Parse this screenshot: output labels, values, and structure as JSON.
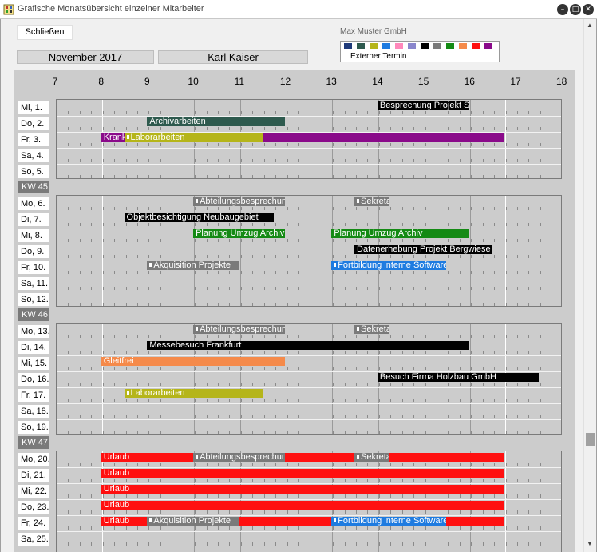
{
  "window": {
    "title": "Grafische Monatsübersicht einzelner Mitarbeiter"
  },
  "toolbar": {
    "close_label": "Schließen",
    "month": "November 2017",
    "employee": "Karl Kaiser"
  },
  "company": "Max Muster GmbH",
  "legend": {
    "colors": [
      "#1f3a7a",
      "#2e5a4e",
      "#b5b51a",
      "#1e7be0",
      "#ff88bb",
      "#8a86cc",
      "#000000",
      "#7a7a7a",
      "#148a14",
      "#f58a4a",
      "#ff1010",
      "#8a0a8a"
    ],
    "label": "Externer Termin"
  },
  "hours": [
    "7",
    "8",
    "9",
    "10",
    "11",
    "12",
    "13",
    "14",
    "15",
    "16",
    "17",
    "18"
  ],
  "weeks": [
    {
      "kw": null,
      "days": [
        "Mi,  1.",
        "Do, 2.",
        "Fr,  3.",
        "Sa, 4.",
        "So, 5."
      ]
    },
    {
      "kw": "KW 45",
      "days": [
        "Mo, 6.",
        "Di,  7.",
        "Mi,  8.",
        "Do, 9.",
        "Fr,  10.",
        "Sa, 11.",
        "So, 12."
      ]
    },
    {
      "kw": "KW 46",
      "days": [
        "Mo, 13.",
        "Di,  14.",
        "Mi,  15.",
        "Do, 16.",
        "Fr,  17.",
        "Sa, 18.",
        "So, 19."
      ]
    },
    {
      "kw": "KW 47",
      "days": [
        "Mo, 20.",
        "Di,  21.",
        "Mi,  22.",
        "Do, 23.",
        "Fr,  24.",
        "Sa, 25."
      ]
    }
  ],
  "events": [
    {
      "week": 0,
      "row": 0,
      "start": 14.0,
      "end": 16.0,
      "label": "Besprechung Projekt Schulung",
      "color": "#000000",
      "marker": false
    },
    {
      "week": 0,
      "row": 1,
      "start": 9.0,
      "end": 12.0,
      "label": "Archivarbeiten",
      "color": "#2e5a4e",
      "marker": false
    },
    {
      "week": 0,
      "row": 2,
      "start": 8.0,
      "end": 16.75,
      "label": "Krank",
      "color": "#8a0a8a",
      "marker": false
    },
    {
      "week": 0,
      "row": 2,
      "start": 8.5,
      "end": 11.5,
      "label": "Laborarbeiten",
      "color": "#b5b51a",
      "marker": true
    },
    {
      "week": 1,
      "row": 0,
      "start": 10.0,
      "end": 12.0,
      "label": "Abteilungsbesprechung",
      "color": "#7a7a7a",
      "marker": true
    },
    {
      "week": 1,
      "row": 0,
      "start": 13.5,
      "end": 14.25,
      "label": "Sekretariat",
      "color": "#7a7a7a",
      "marker": true
    },
    {
      "week": 1,
      "row": 1,
      "start": 8.5,
      "end": 11.75,
      "label": "Objektbesichtigung Neubaugebiet",
      "color": "#000000",
      "marker": false
    },
    {
      "week": 1,
      "row": 2,
      "start": 10.0,
      "end": 12.0,
      "label": "Planung Umzug Archiv",
      "color": "#148a14",
      "marker": false
    },
    {
      "week": 1,
      "row": 2,
      "start": 13.0,
      "end": 16.0,
      "label": "Planung Umzug Archiv",
      "color": "#148a14",
      "marker": false
    },
    {
      "week": 1,
      "row": 3,
      "start": 13.5,
      "end": 16.5,
      "label": "Datenerhebung Projekt Bergwiese",
      "color": "#000000",
      "marker": false
    },
    {
      "week": 1,
      "row": 4,
      "start": 9.0,
      "end": 11.0,
      "label": "Akquisition Projekte",
      "color": "#7a7a7a",
      "marker": true
    },
    {
      "week": 1,
      "row": 4,
      "start": 13.0,
      "end": 15.5,
      "label": "Fortbildung interne Software",
      "color": "#1e7be0",
      "marker": true
    },
    {
      "week": 2,
      "row": 0,
      "start": 10.0,
      "end": 12.0,
      "label": "Abteilungsbesprechung",
      "color": "#7a7a7a",
      "marker": true
    },
    {
      "week": 2,
      "row": 0,
      "start": 13.5,
      "end": 14.25,
      "label": "Sekretariat",
      "color": "#7a7a7a",
      "marker": true
    },
    {
      "week": 2,
      "row": 1,
      "start": 9.0,
      "end": 16.0,
      "label": "Messebesuch Frankfurt",
      "color": "#000000",
      "marker": false
    },
    {
      "week": 2,
      "row": 2,
      "start": 8.0,
      "end": 12.0,
      "label": "Gleitfrei",
      "color": "#f58a4a",
      "marker": false
    },
    {
      "week": 2,
      "row": 3,
      "start": 14.0,
      "end": 17.5,
      "label": "Besuch Firma Holzbau GmbH",
      "color": "#000000",
      "marker": false
    },
    {
      "week": 2,
      "row": 4,
      "start": 8.5,
      "end": 11.5,
      "label": "Laborarbeiten",
      "color": "#b5b51a",
      "marker": true
    },
    {
      "week": 3,
      "row": 0,
      "start": 8.0,
      "end": 16.75,
      "label": "Urlaub",
      "color": "#ff1010",
      "marker": false
    },
    {
      "week": 3,
      "row": 0,
      "start": 10.0,
      "end": 12.0,
      "label": "Abteilungsbesprechung",
      "color": "#7a7a7a",
      "marker": true
    },
    {
      "week": 3,
      "row": 0,
      "start": 13.5,
      "end": 14.25,
      "label": "Sekretariat",
      "color": "#7a7a7a",
      "marker": true
    },
    {
      "week": 3,
      "row": 1,
      "start": 8.0,
      "end": 16.75,
      "label": "Urlaub",
      "color": "#ff1010",
      "marker": false
    },
    {
      "week": 3,
      "row": 2,
      "start": 8.0,
      "end": 16.75,
      "label": "Urlaub",
      "color": "#ff1010",
      "marker": false
    },
    {
      "week": 3,
      "row": 3,
      "start": 8.0,
      "end": 16.75,
      "label": "Urlaub",
      "color": "#ff1010",
      "marker": false
    },
    {
      "week": 3,
      "row": 4,
      "start": 8.0,
      "end": 16.75,
      "label": "Urlaub",
      "color": "#ff1010",
      "marker": false
    },
    {
      "week": 3,
      "row": 4,
      "start": 9.0,
      "end": 11.0,
      "label": "Akquisition Projekte",
      "color": "#7a7a7a",
      "marker": true
    },
    {
      "week": 3,
      "row": 4,
      "start": 13.0,
      "end": 15.5,
      "label": "Fortbildung interne Software",
      "color": "#1e7be0",
      "marker": true
    }
  ]
}
